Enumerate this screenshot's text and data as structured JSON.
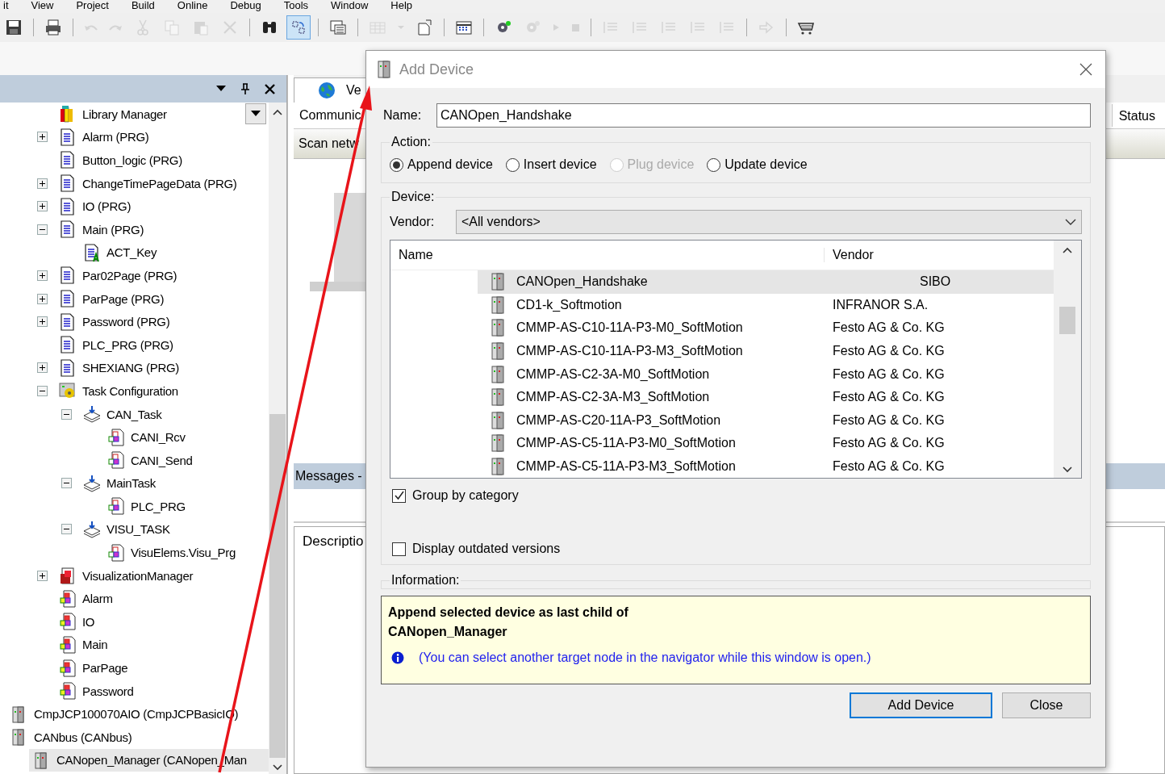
{
  "menu": [
    "it",
    "View",
    "Project",
    "Build",
    "Online",
    "Debug",
    "Tools",
    "Window",
    "Help"
  ],
  "toolbar": [
    [
      {
        "kind": "save",
        "disabled": false,
        "pressed": false
      }
    ],
    [
      {
        "kind": "print",
        "disabled": false,
        "pressed": false
      }
    ],
    [
      {
        "kind": "undo",
        "disabled": true,
        "pressed": false
      },
      {
        "kind": "redo",
        "disabled": true,
        "pressed": false
      },
      {
        "kind": "cut",
        "disabled": true,
        "pressed": false
      },
      {
        "kind": "copy",
        "disabled": true,
        "pressed": false
      },
      {
        "kind": "paste",
        "disabled": true,
        "pressed": false
      },
      {
        "kind": "delete",
        "disabled": true,
        "pressed": false
      }
    ],
    [
      {
        "kind": "find",
        "disabled": false,
        "pressed": false
      },
      {
        "kind": "replace",
        "disabled": false,
        "pressed": true
      }
    ],
    [
      {
        "kind": "window",
        "disabled": false,
        "pressed": false
      }
    ],
    [
      {
        "kind": "grid",
        "disabled": true,
        "pressed": false
      },
      {
        "kind": "caret",
        "disabled": true,
        "pressed": false
      },
      {
        "kind": "page",
        "disabled": false,
        "pressed": false
      }
    ],
    [
      {
        "kind": "matrix",
        "disabled": false,
        "pressed": false
      }
    ],
    [
      {
        "kind": "gear",
        "disabled": false,
        "pressed": false
      },
      {
        "kind": "gear",
        "disabled": true,
        "pressed": false
      },
      {
        "kind": "play",
        "disabled": true,
        "pressed": false
      },
      {
        "kind": "stop",
        "disabled": true,
        "pressed": false
      }
    ],
    [
      {
        "kind": "lines",
        "disabled": true,
        "pressed": false
      },
      {
        "kind": "lines",
        "disabled": true,
        "pressed": false
      },
      {
        "kind": "lines",
        "disabled": true,
        "pressed": false
      },
      {
        "kind": "lines",
        "disabled": true,
        "pressed": false
      },
      {
        "kind": "lines",
        "disabled": true,
        "pressed": false
      }
    ],
    [
      {
        "kind": "arrow",
        "disabled": true,
        "pressed": false
      }
    ],
    [
      {
        "kind": "cart",
        "disabled": false,
        "pressed": false
      }
    ]
  ],
  "tree": {
    "application_items": [
      {
        "label": "Library Manager",
        "kind": "library",
        "selected": false
      },
      {
        "label": "Alarm (PRG)",
        "kind": "prg",
        "expanded": false,
        "selected": false
      },
      {
        "label": "Button_logic (PRG)",
        "kind": "prg",
        "selected": false
      },
      {
        "label": "ChangeTimePageData (PRG)",
        "kind": "prg",
        "expanded": false,
        "selected": false
      },
      {
        "label": "IO (PRG)",
        "kind": "prg",
        "expanded": false,
        "selected": false
      },
      {
        "label": "Main (PRG)",
        "kind": "prg",
        "expanded": true,
        "selected": false,
        "children": [
          {
            "label": "ACT_Key",
            "kind": "action",
            "selected": false
          }
        ]
      },
      {
        "label": "Par02Page (PRG)",
        "kind": "prg",
        "expanded": false,
        "selected": false
      },
      {
        "label": "ParPage (PRG)",
        "kind": "prg",
        "expanded": false,
        "selected": false
      },
      {
        "label": "Password (PRG)",
        "kind": "prg",
        "expanded": false,
        "selected": false
      },
      {
        "label": "PLC_PRG (PRG)",
        "kind": "prg",
        "selected": false
      },
      {
        "label": "SHEXIANG (PRG)",
        "kind": "prg",
        "expanded": false,
        "selected": false
      },
      {
        "label": "Task Configuration",
        "kind": "taskconfig",
        "expanded": true,
        "selected": false,
        "children": [
          {
            "label": "CAN_Task",
            "kind": "task",
            "expanded": true,
            "selected": false,
            "children": [
              {
                "label": "CANI_Rcv",
                "kind": "call",
                "selected": false
              },
              {
                "label": "CANI_Send",
                "kind": "call",
                "selected": false
              }
            ]
          },
          {
            "label": "MainTask",
            "kind": "task",
            "expanded": true,
            "selected": false,
            "children": [
              {
                "label": "PLC_PRG",
                "kind": "call",
                "selected": false
              }
            ]
          },
          {
            "label": "VISU_TASK",
            "kind": "task",
            "expanded": true,
            "selected": false,
            "children": [
              {
                "label": "VisuElems.Visu_Prg",
                "kind": "call",
                "selected": false
              }
            ]
          }
        ]
      },
      {
        "label": "VisualizationManager",
        "kind": "visumanager",
        "expanded": false,
        "selected": false
      },
      {
        "label": "Alarm",
        "kind": "visu",
        "selected": false
      },
      {
        "label": "IO",
        "kind": "visu",
        "selected": false
      },
      {
        "label": "Main",
        "kind": "visu",
        "selected": false
      },
      {
        "label": "ParPage",
        "kind": "visu",
        "selected": false
      },
      {
        "label": "Password",
        "kind": "visu",
        "selected": false
      }
    ],
    "device_items": [
      {
        "label": "CmpJCP100070AIO (CmpJCPBasicIO)",
        "kind": "device",
        "selected": false
      },
      {
        "label": "CANbus (CANbus)",
        "kind": "device",
        "selected": false,
        "children": [
          {
            "label": "CANopen_Manager (CANopen_Man",
            "kind": "device",
            "selected": true
          }
        ]
      }
    ]
  },
  "editor": {
    "tab": "Ve",
    "header_left": "Communic",
    "header_right": "Status",
    "scan_button": "Scan netw",
    "messages_header": "Messages -",
    "description_header": "Descriptio"
  },
  "dialog": {
    "title": "Add Device",
    "name_label": "Name:",
    "name_value": "CANOpen_Handshake",
    "action_legend": "Action:",
    "actions": [
      {
        "label": "Append device",
        "selected": true,
        "disabled": false
      },
      {
        "label": "Insert device",
        "selected": false,
        "disabled": false
      },
      {
        "label": "Plug device",
        "selected": false,
        "disabled": true
      },
      {
        "label": "Update device",
        "selected": false,
        "disabled": false
      }
    ],
    "device_legend": "Device:",
    "vendor_label": "Vendor:",
    "vendor_value": "<All vendors>",
    "list": {
      "columns": [
        "Name",
        "Vendor"
      ],
      "rows": [
        {
          "name": "CANOpen_Handshake",
          "vendor": "SIBO",
          "selected": true
        },
        {
          "name": "CD1-k_Softmotion",
          "vendor": "INFRANOR S.A.",
          "selected": false
        },
        {
          "name": "CMMP-AS-C10-11A-P3-M0_SoftMotion",
          "vendor": "Festo AG & Co. KG",
          "selected": false
        },
        {
          "name": "CMMP-AS-C10-11A-P3-M3_SoftMotion",
          "vendor": "Festo AG & Co. KG",
          "selected": false
        },
        {
          "name": "CMMP-AS-C2-3A-M0_SoftMotion",
          "vendor": "Festo AG & Co. KG",
          "selected": false
        },
        {
          "name": "CMMP-AS-C2-3A-M3_SoftMotion",
          "vendor": "Festo AG & Co. KG",
          "selected": false
        },
        {
          "name": "CMMP-AS-C20-11A-P3_SoftMotion",
          "vendor": "Festo AG & Co. KG",
          "selected": false
        },
        {
          "name": "CMMP-AS-C5-11A-P3-M0_SoftMotion",
          "vendor": "Festo AG & Co. KG",
          "selected": false
        },
        {
          "name": "CMMP-AS-C5-11A-P3-M3_SoftMotion",
          "vendor": "Festo AG & Co. KG",
          "selected": false
        }
      ]
    },
    "checkboxes": [
      {
        "label": "Group by category",
        "checked": true
      },
      {
        "label": "Display outdated versions",
        "checked": false
      }
    ],
    "information_legend": "Information:",
    "info_box": {
      "heading": "Append selected device as last child of",
      "target": "CANopen_Manager",
      "note": "(You can select another target node in the navigator while this window is open.)"
    },
    "buttons": [
      {
        "label": "Add Device",
        "default": true
      },
      {
        "label": "Close",
        "default": false
      }
    ]
  }
}
